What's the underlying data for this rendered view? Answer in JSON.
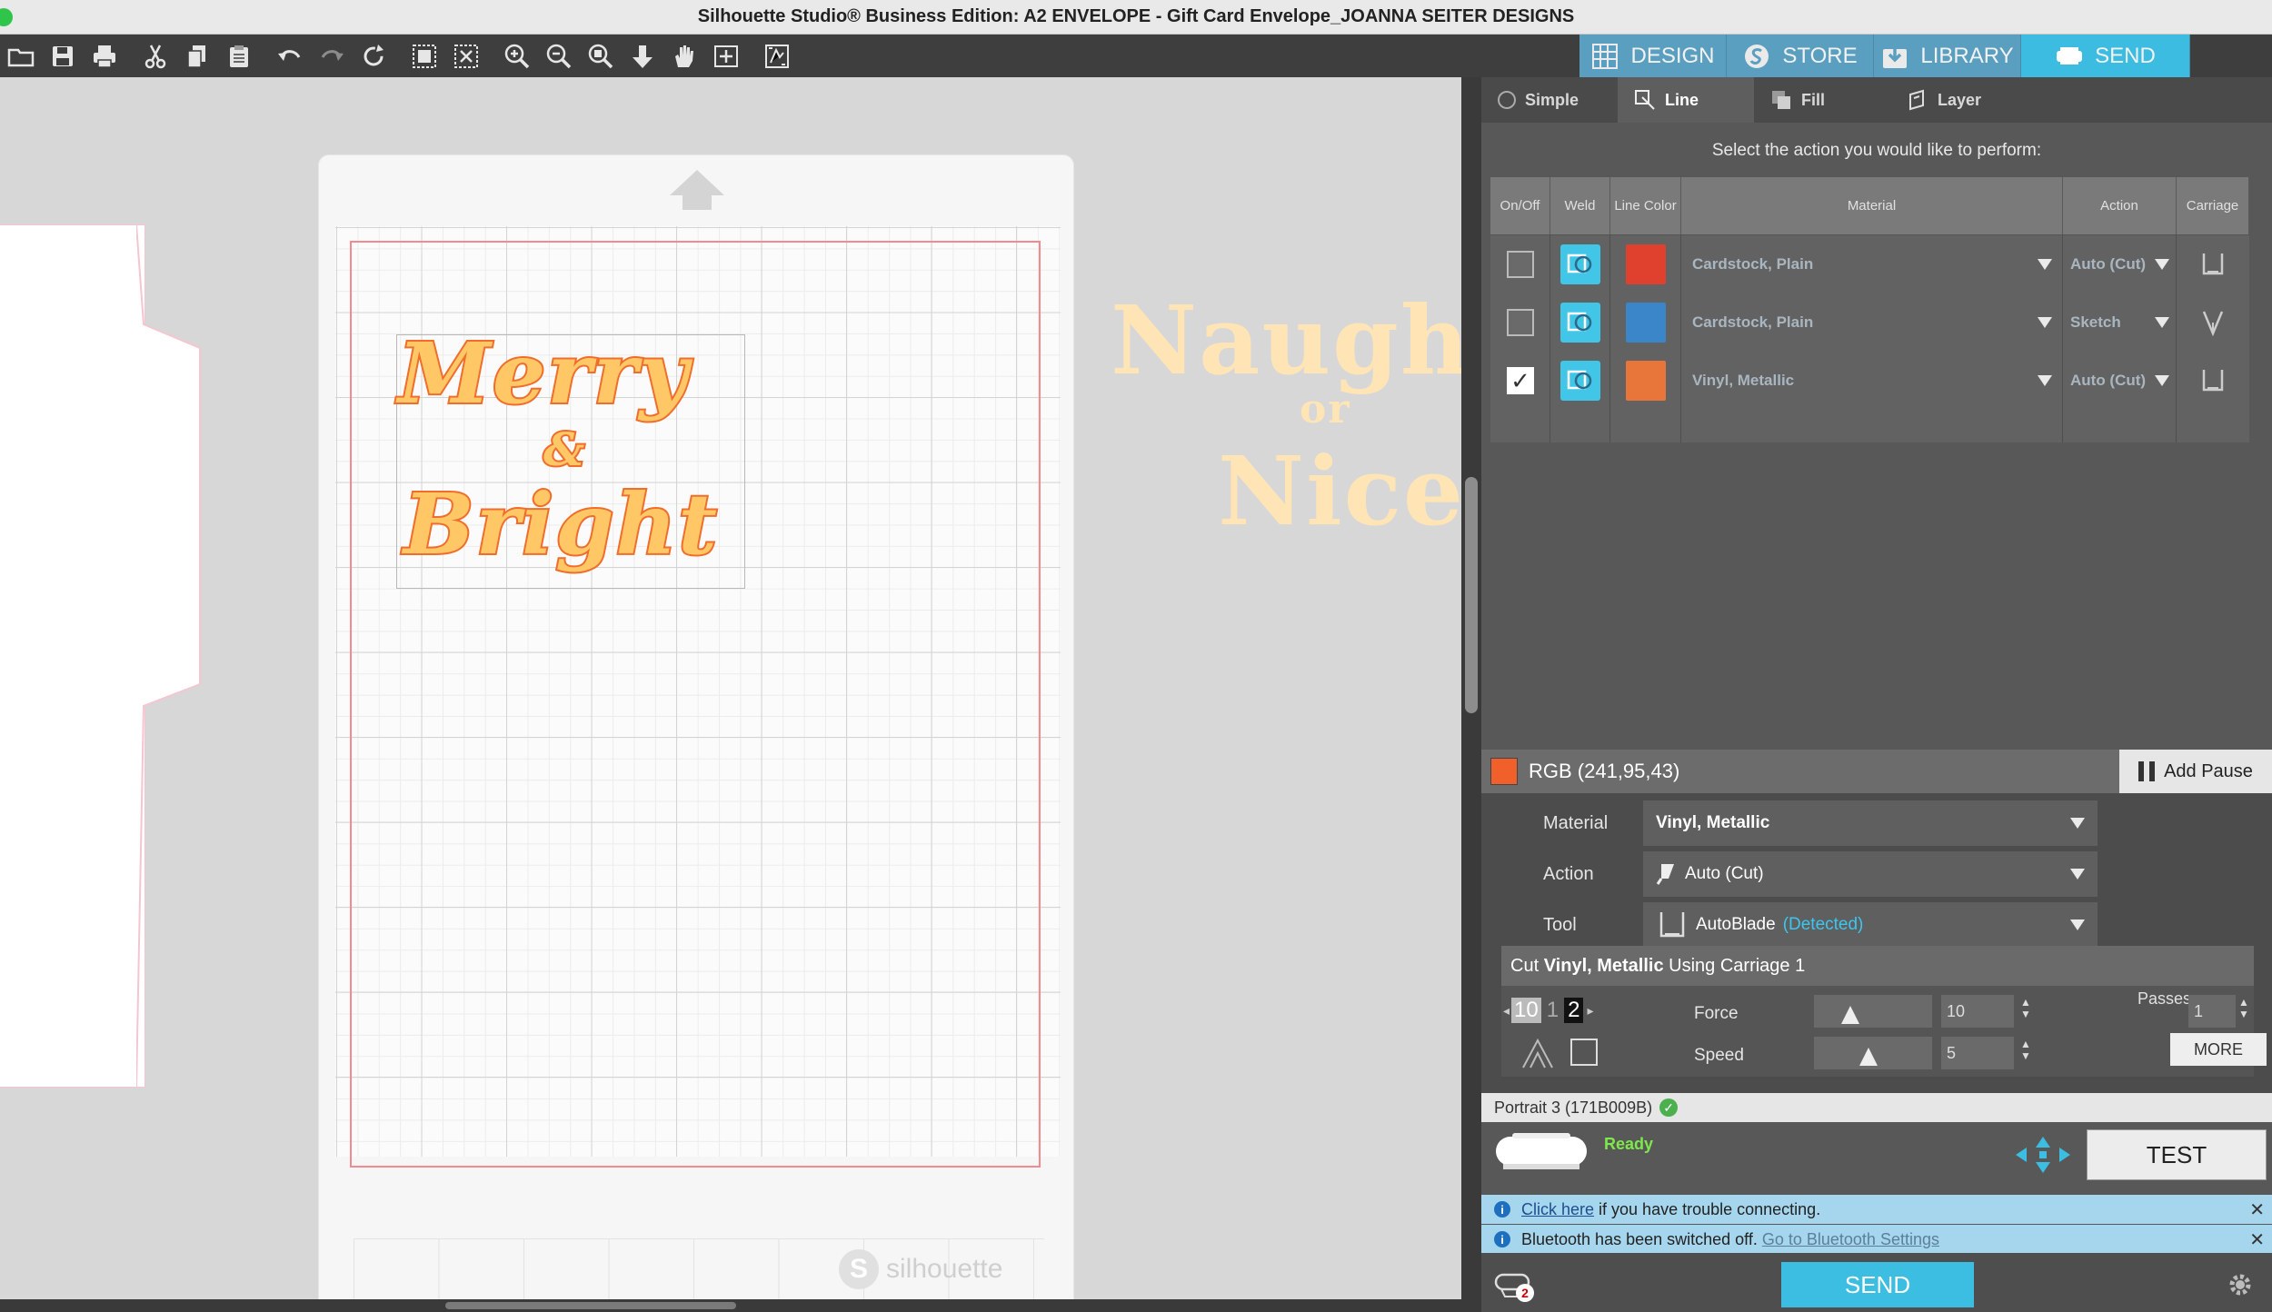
{
  "window": {
    "title": "Silhouette Studio® Business Edition: A2 ENVELOPE - Gift Card Envelope_JOANNA SEITER DESIGNS"
  },
  "toolbar": {
    "tools": [
      "open-icon",
      "save-icon",
      "print-icon",
      "cut-icon",
      "copy-icon",
      "paste-icon",
      "undo-icon",
      "redo-icon",
      "redraw-icon",
      "group-icon",
      "ungroup-icon",
      "zoom-in-icon",
      "zoom-out-icon",
      "zoom-select-icon",
      "pan-down-icon",
      "pan-hand-icon",
      "fit-page-icon",
      "pixscan-icon"
    ]
  },
  "nav_tabs": [
    {
      "label": "DESIGN",
      "icon": "grid-icon",
      "active": false
    },
    {
      "label": "STORE",
      "icon": "store-s-icon",
      "active": false
    },
    {
      "label": "LIBRARY",
      "icon": "library-download-icon",
      "active": false
    },
    {
      "label": "SEND",
      "icon": "cutter-icon",
      "active": true
    }
  ],
  "canvas": {
    "design_line1": "Merry",
    "design_amp": "&",
    "design_line2": "Bright",
    "offmat_line1": "Naughty",
    "offmat_or": "or",
    "offmat_line2": "Nice",
    "mat_brand": "silhouette",
    "accent_fill": "#ffc766",
    "accent_stroke": "#f06d2b"
  },
  "send_panel": {
    "sub_tabs": [
      {
        "label": "Simple",
        "active": false
      },
      {
        "label": "Line",
        "active": true
      },
      {
        "label": "Fill",
        "active": false
      },
      {
        "label": "Layer",
        "active": false
      }
    ],
    "instruction": "Select the action you would like to perform:",
    "table": {
      "headers": [
        "On/Off",
        "Weld",
        "Line Color",
        "Material",
        "Action",
        "Carriage"
      ],
      "rows": [
        {
          "checked": false,
          "color": "#e0402e",
          "material": "Cardstock, Plain",
          "action": "Auto (Cut)"
        },
        {
          "checked": false,
          "color": "#3a86c8",
          "material": "Cardstock, Plain",
          "action": "Sketch"
        },
        {
          "checked": true,
          "color": "#e8763a",
          "material": "Vinyl, Metallic",
          "action": "Auto (Cut)"
        }
      ]
    },
    "selected_color_label": "RGB (241,95,43)",
    "add_pause": "Add Pause",
    "settings": {
      "material_label": "Material",
      "material_value": "Vinyl, Metallic",
      "action_label": "Action",
      "action_value": "Auto (Cut)",
      "tool_label": "Tool",
      "tool_value": "AutoBlade",
      "tool_detected": "(Detected)",
      "cut_heading_pre": "Cut ",
      "cut_heading_material": "Vinyl, Metallic",
      "cut_heading_post": " Using Carriage 1",
      "blade_depth_from": "10",
      "blade_depth_mid": "1",
      "blade_depth_to": "2",
      "force_label": "Force",
      "force_value": "10",
      "speed_label": "Speed",
      "speed_value": "5",
      "passes_label": "Passes",
      "passes_value": "1",
      "more": "MORE"
    },
    "device": {
      "name": "Portrait 3 (171B009B)",
      "status": "Ready",
      "test": "TEST"
    },
    "info": [
      {
        "link": "Click here",
        "text": " if you have trouble connecting."
      },
      {
        "text": "Bluetooth has been switched off. ",
        "link": "Go to Bluetooth Settings"
      }
    ],
    "send": "SEND",
    "queue_badge": "2"
  }
}
